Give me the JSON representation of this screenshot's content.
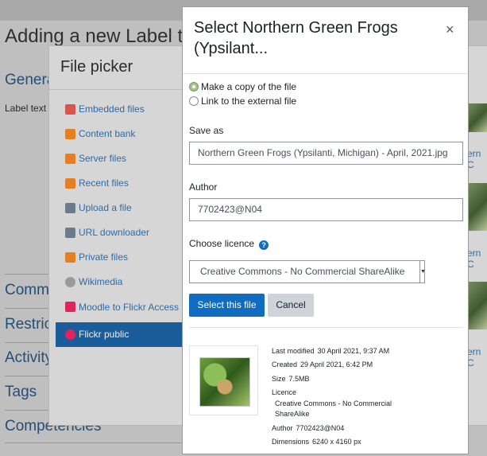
{
  "background": {
    "page_title": "Adding a new Label t",
    "general_heading": "Genera",
    "label_text": "Label text",
    "headings": [
      "Comm",
      "Restric",
      "Activity",
      "Tags",
      "Competencies"
    ],
    "thumb_labels": [
      "ern C",
      "ern C",
      "ern C"
    ]
  },
  "file_picker": {
    "title": "File picker",
    "nav": [
      {
        "label": "Embedded files",
        "icon": "embedded-files-icon",
        "color": "#d9534f"
      },
      {
        "label": "Content bank",
        "icon": "content-bank-icon",
        "color": "#e67e22"
      },
      {
        "label": "Server files",
        "icon": "server-files-icon",
        "color": "#e67e22"
      },
      {
        "label": "Recent files",
        "icon": "recent-files-icon",
        "color": "#e67e22"
      },
      {
        "label": "Upload a file",
        "icon": "upload-icon",
        "color": "#6c7a89"
      },
      {
        "label": "URL downloader",
        "icon": "url-downloader-icon",
        "color": "#6c7a89"
      },
      {
        "label": "Private files",
        "icon": "private-files-icon",
        "color": "#e67e22"
      },
      {
        "label": "Wikimedia",
        "icon": "wikimedia-icon",
        "color": "#9a9a9a"
      },
      {
        "label": "Moodle to Flickr Access",
        "icon": "flickr-icon",
        "color": "#e0245e"
      },
      {
        "label": "Flickr public",
        "icon": "flickr-public-icon",
        "color": "#e0245e"
      }
    ],
    "active_item": "Flickr public"
  },
  "dialog": {
    "title": "Select Northern Green Frogs (Ypsilant...",
    "close_glyph": "×",
    "radio_copy": "Make a copy of the file",
    "radio_link": "Link to the external file",
    "save_as_label": "Save as",
    "save_as_value": "Northern Green Frogs (Ypsilanti, Michigan) - April, 2021.jpg",
    "author_label": "Author",
    "author_value": "7702423@N04",
    "licence_label": "Choose licence",
    "help_glyph": "?",
    "licence_value": "Creative Commons - No Commercial ShareAlike",
    "select_button": "Select this file",
    "cancel_button": "Cancel",
    "meta": {
      "last_modified_label": "Last modified",
      "last_modified_value": "30 April 2021, 9:37 AM",
      "created_label": "Created",
      "created_value": "29 April 2021, 6:42 PM",
      "size_label": "Size",
      "size_value": "7.5MB",
      "licence_label": "Licence",
      "licence_value_line1": "Creative Commons - No Commercial",
      "licence_value_line2": "ShareAlike",
      "author_label": "Author",
      "author_value": "7702423@N04",
      "dimensions_label": "Dimensions",
      "dimensions_value": "6240 x 4160 px"
    }
  }
}
